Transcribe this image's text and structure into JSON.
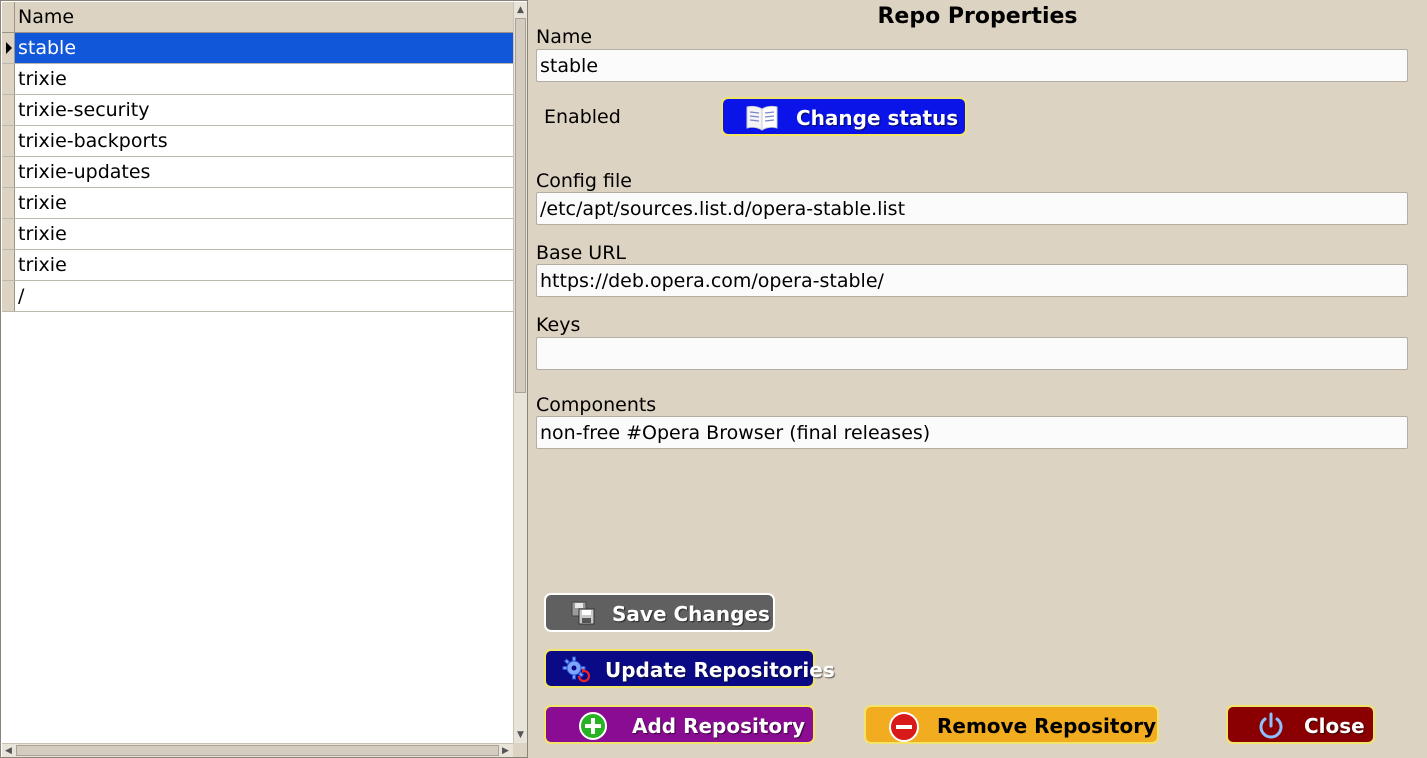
{
  "grid": {
    "header": "Name",
    "rows": [
      "stable",
      "trixie",
      "trixie-security",
      "trixie-backports",
      "trixie-updates",
      "trixie",
      "trixie",
      "trixie",
      "/"
    ],
    "selected_index": 0
  },
  "form": {
    "title": "Repo Properties",
    "name_label": "Name",
    "name_value": "stable",
    "enabled_label": "Enabled",
    "change_status_label": "Change status",
    "config_file_label": "Config file",
    "config_file_value": "/etc/apt/sources.list.d/opera-stable.list",
    "base_url_label": "Base URL",
    "base_url_value": "https://deb.opera.com/opera-stable/",
    "keys_label": "Keys",
    "keys_value": "",
    "components_label": "Components",
    "components_value": "non-free #Opera Browser (final releases)"
  },
  "buttons": {
    "save": "Save Changes",
    "update": "Update Repositories",
    "add": "Add Repository",
    "remove": "Remove Repository",
    "close": "Close"
  },
  "colors": {
    "background": "#ddd3c2",
    "selection": "#1157d9",
    "change_status": "#0a14e8",
    "save": "#606060",
    "update": "#0a0a86",
    "add": "#8a0c92",
    "remove": "#f2ac20",
    "close": "#8a0000",
    "button_border": "#f0e56a"
  },
  "icons": {
    "change_status": "book-icon",
    "save": "floppy-disks-icon",
    "update": "gear-refresh-icon",
    "add": "plus-circle-icon",
    "remove": "minus-circle-icon",
    "close": "power-icon"
  }
}
